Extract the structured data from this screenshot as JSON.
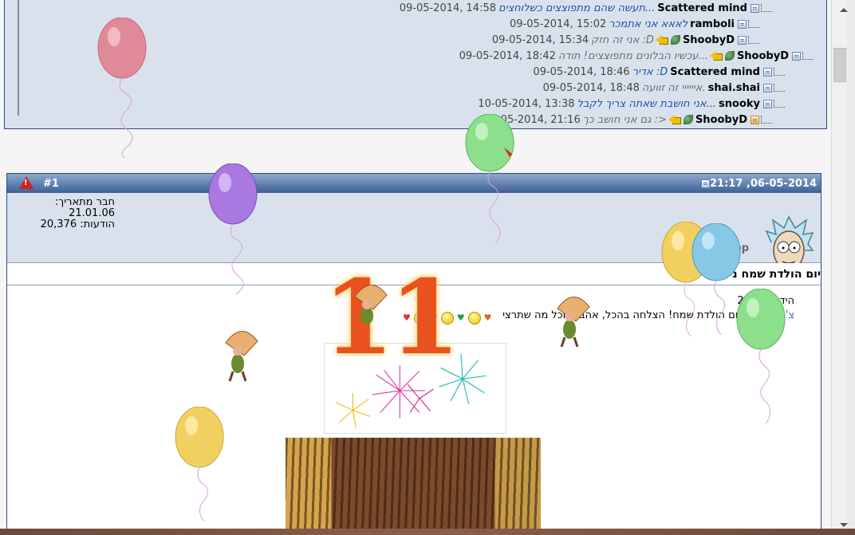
{
  "thread": {
    "rows": [
      {
        "author": "Scattered mind",
        "title": "תעשה שהם מתפוצצים כשלוחצים...",
        "title_style": "blue",
        "date": "09-05-2014, 14:58",
        "icons": []
      },
      {
        "author": "ramboli",
        "title": "לאאא אני אתמכר",
        "title_style": "blue",
        "date": "09-05-2014, 15:02",
        "icons": []
      },
      {
        "author": "ShoobyD",
        "title": "אני זה חזק :D",
        "title_style": "gray",
        "date": "09-05-2014, 15:34",
        "icons": [
          "leaf-icon",
          "arrow-icon"
        ]
      },
      {
        "author": "ShoobyD",
        "title": "עכשיו הבלונים מתפוצצים! תודה...",
        "title_style": "gray",
        "date": "09-05-2014, 18:42",
        "icons": [
          "leaf-icon",
          "arrow-icon"
        ]
      },
      {
        "author": "Scattered mind",
        "title": "אדיר :D",
        "title_style": "blue",
        "date": "09-05-2014, 18:46",
        "icons": []
      },
      {
        "author": "shai.shai",
        "title": "איייייי זה זוועה.",
        "title_style": "gray",
        "date": "09-05-2014, 18:48",
        "icons": []
      },
      {
        "author": "snooky",
        "title": "אני חושבת שאתה צריך לקבל...",
        "title_style": "blue",
        "date": "10-05-2014, 13:38",
        "icons": []
      },
      {
        "author": "ShoobyD",
        "title": "גם אני חושב כך :>",
        "title_style": "gray",
        "date": "12-05-2014, 21:16",
        "icons": [
          "leaf-icon",
          "arrow-icon"
        ],
        "orange": true
      }
    ]
  },
  "post": {
    "date": "06-05-2014, 21:17",
    "number": "#1",
    "join_label": "חבר מתאריך: 21.01.06",
    "posts_label": "הודעות: 20,376",
    "username": "sheep",
    "title": "יום הולדת שמח נייטרי",
    "body_line1": "הידד! בת 20",
    "body_line2_prefix": "צ'יבורשקה,",
    "body_line2": "יום הולדת שמח! הצלחה בהכל, אהבה, וכל מה שתרצי",
    "big_number": "11"
  },
  "colors": {
    "header_dark": "#3c5f95",
    "panel_bg": "#d9e2ec",
    "border": "#2d4b89",
    "link": "#1d4fa8",
    "number_orange": "#e8521e"
  }
}
